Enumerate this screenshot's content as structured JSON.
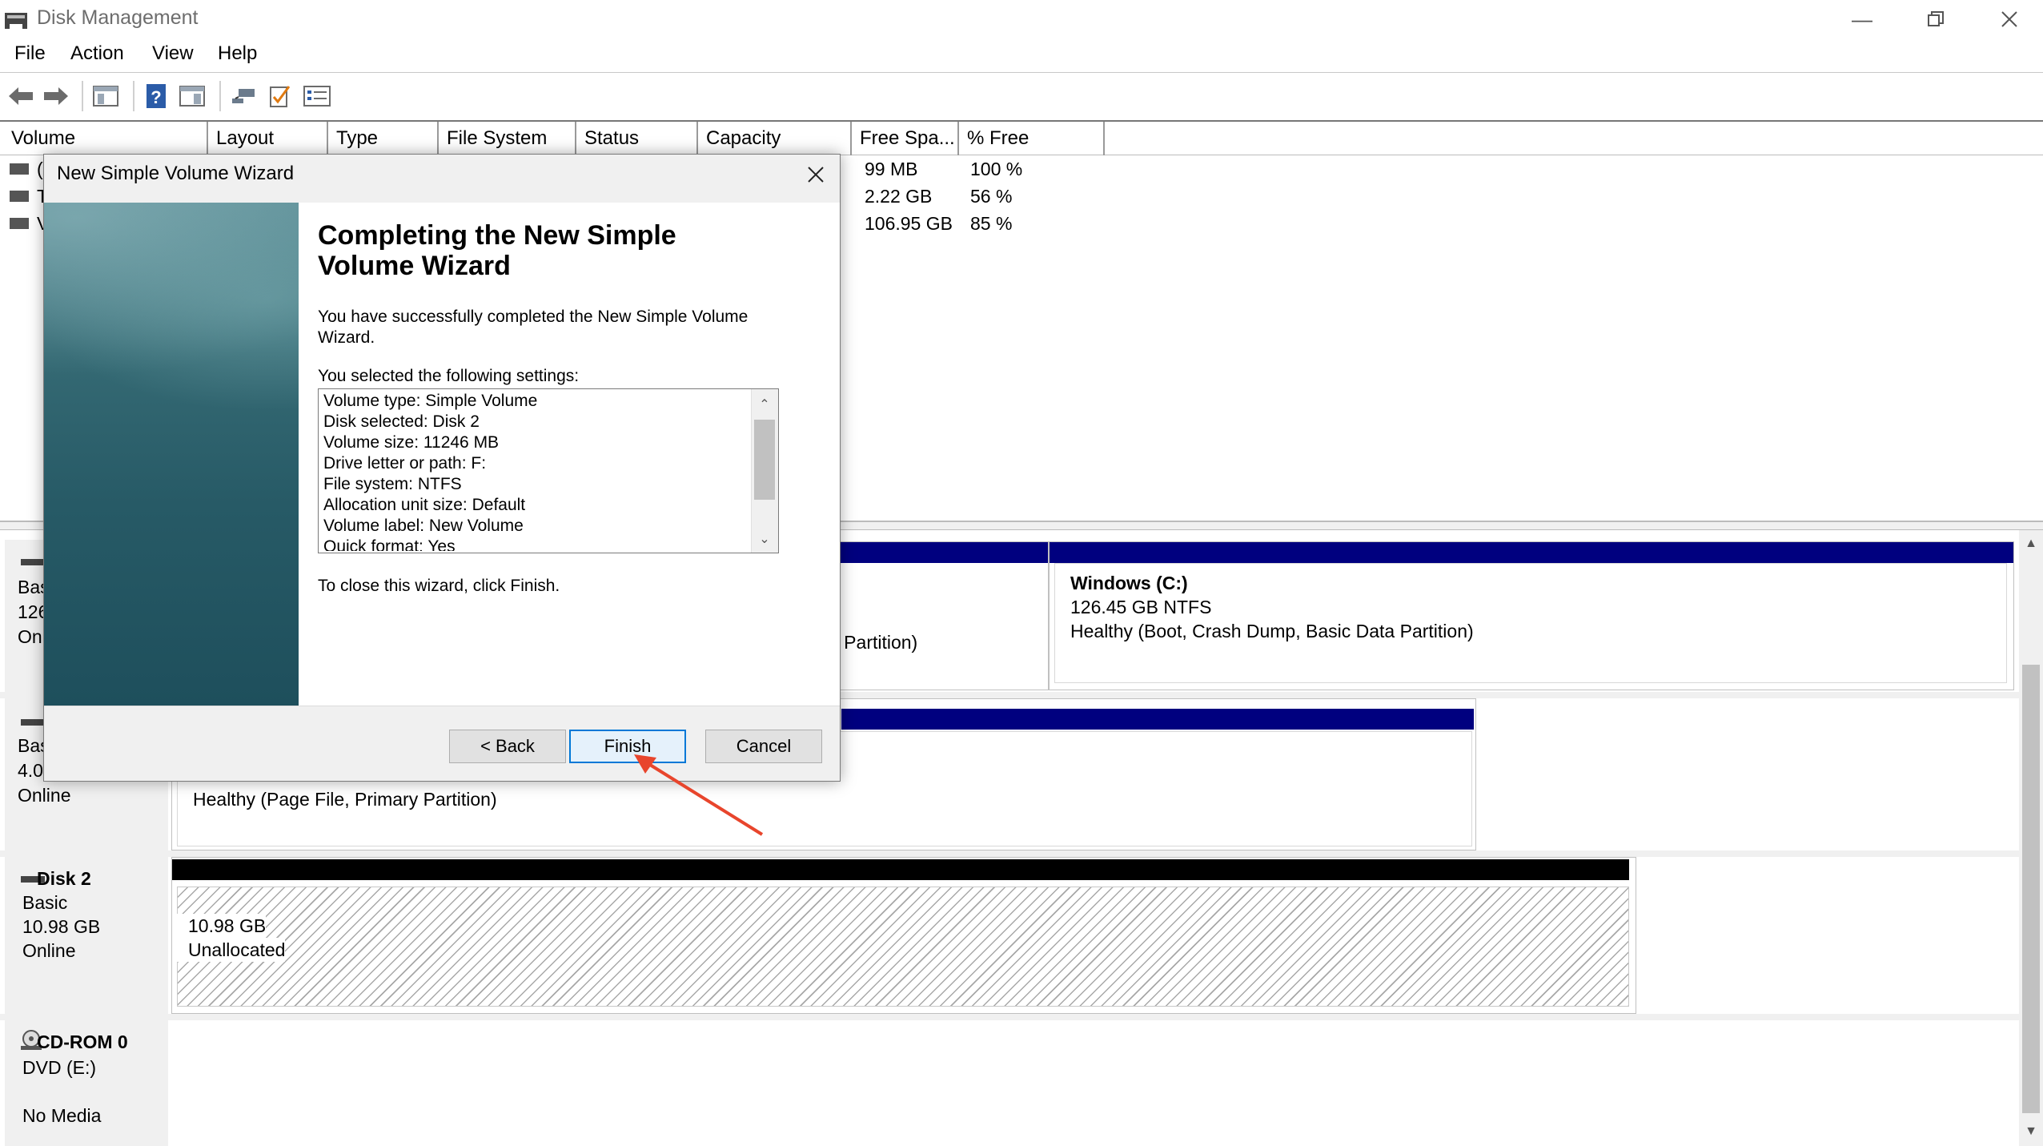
{
  "window": {
    "title": "Disk Management"
  },
  "menu": [
    "File",
    "Action",
    "View",
    "Help"
  ],
  "volume_table": {
    "columns": [
      "Volume",
      "Layout",
      "Type",
      "File System",
      "Status",
      "Capacity",
      "Free Spa...",
      "% Free"
    ],
    "rows": [
      {
        "vol_partial": "(",
        "free": "99 MB",
        "pct": "100 %"
      },
      {
        "vol_partial": "T",
        "free": "2.22 GB",
        "pct": "56 %"
      },
      {
        "vol_partial": "V",
        "free": "106.95 GB",
        "pct": "85 %"
      }
    ]
  },
  "disks": {
    "disk0": {
      "label_lines": [
        "Bas",
        "126",
        "On"
      ],
      "partition_c": {
        "name": "Windows  (C:)",
        "size": "126.45 GB NTFS",
        "status": "Healthy (Boot, Crash Dump, Basic Data Partition)"
      },
      "partial_text": "n Partition)"
    },
    "disk1": {
      "label_lines": [
        "Bas",
        "4.0",
        "Online"
      ],
      "partition_status": "Healthy (Page File, Primary Partition)"
    },
    "disk2": {
      "name": "Disk 2",
      "type": "Basic",
      "size": "10.98 GB",
      "status": "Online",
      "unallocated_size": "10.98 GB",
      "unallocated_label": "Unallocated"
    },
    "cdrom": {
      "name": "CD-ROM 0",
      "drive": "DVD (E:)",
      "status": "No Media"
    }
  },
  "wizard": {
    "title": "New Simple Volume Wizard",
    "heading": "Completing the New Simple Volume Wizard",
    "intro": "You have successfully completed the New Simple Volume Wizard.",
    "settings_label": "You selected the following settings:",
    "settings": [
      "Volume type: Simple Volume",
      "Disk selected: Disk 2",
      "Volume size: 11246 MB",
      "Drive letter or path: F:",
      "File system: NTFS",
      "Allocation unit size: Default",
      "Volume label: New Volume",
      "Quick format: Yes"
    ],
    "close_hint": "To close this wizard, click Finish.",
    "buttons": {
      "back": "< Back",
      "finish": "Finish",
      "cancel": "Cancel"
    }
  },
  "colors": {
    "primary_partition_bar": "#00007f",
    "unallocated_bar": "#000000",
    "accent": "#0078d7",
    "annotation_arrow": "#e8452c"
  },
  "icons": [
    "disk-management-icon",
    "back-arrow-icon",
    "forward-arrow-icon",
    "console-tree-icon",
    "help-icon",
    "properties-icon",
    "connect-icon",
    "check-icon",
    "list-icon",
    "minimize-icon",
    "restore-icon",
    "close-icon",
    "disk-icon",
    "cdrom-icon"
  ]
}
